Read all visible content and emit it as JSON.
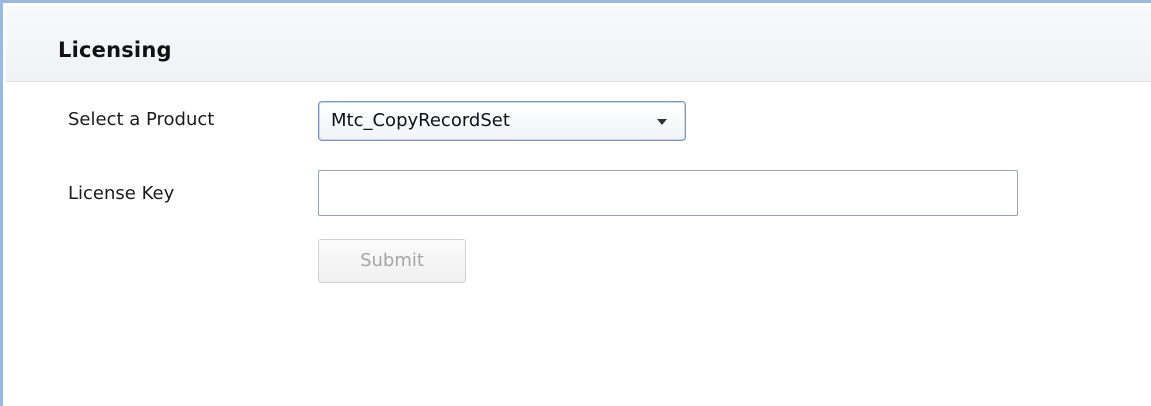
{
  "panel": {
    "title": "Licensing"
  },
  "form": {
    "product_label": "Select a Product",
    "product_selected": "Mtc_CopyRecordSet",
    "license_key_label": "License Key",
    "license_key_value": "",
    "submit_label": "Submit",
    "submit_enabled": false
  },
  "colors": {
    "frame_border": "#9cb8dc",
    "header_bg": "#eff2f6",
    "select_border": "#7a96b8",
    "disabled_text": "#a6a6a6"
  },
  "icons": {
    "dropdown": "chevron-down-icon"
  }
}
